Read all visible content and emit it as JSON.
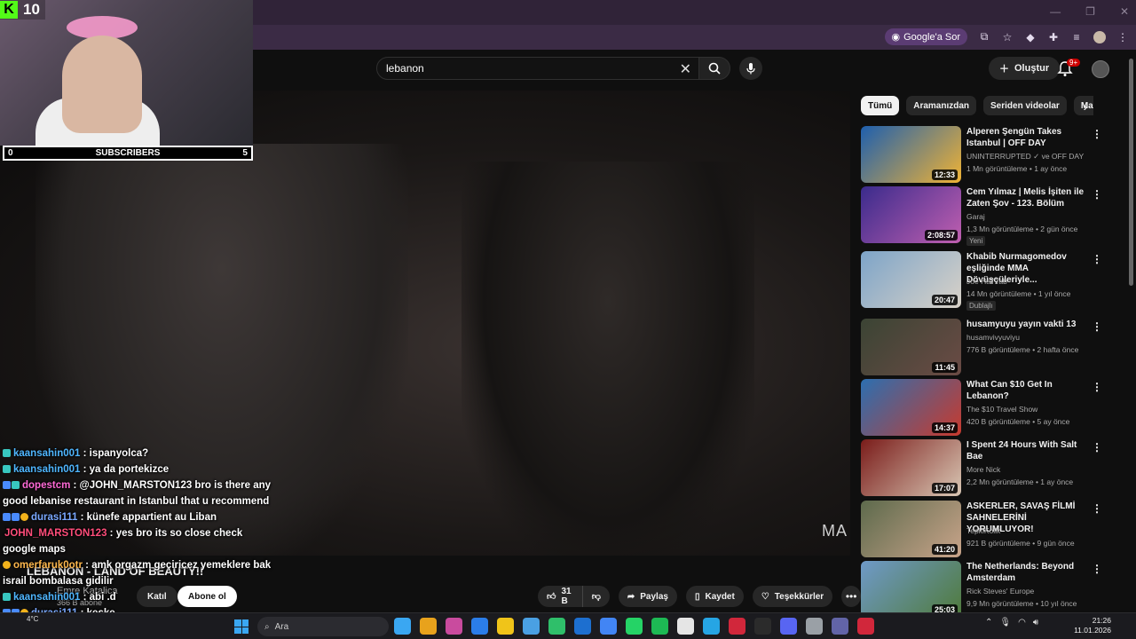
{
  "browser": {
    "google_ask": "Google'a Sor"
  },
  "header": {
    "search_value": "lebanon",
    "create_label": "Oluştur",
    "notif_count": "9+"
  },
  "stream_overlay": {
    "kick_count": "10",
    "subs_left": "0",
    "subs_label": "SUBSCRIBERS",
    "subs_right": "5",
    "accent": "#53fc18"
  },
  "chat": [
    {
      "user": "kaansahin001",
      "text": ": ispanyolca?",
      "color": "#4fb6ff",
      "badges": [
        "teal"
      ]
    },
    {
      "user": "kaansahin001",
      "text": ": ya da portekizce",
      "color": "#4fb6ff",
      "badges": [
        "teal"
      ]
    },
    {
      "user": "dopestcm",
      "text": ": @JOHN_MARSTON123 bro is there any good lebanise restaurant in Istanbul that u recommend",
      "color": "#ff6ad5",
      "badges": [
        "blue",
        "teal"
      ]
    },
    {
      "user": "durasi111",
      "text": ": künefe appartient au Liban",
      "color": "#7aa8ff",
      "badges": [
        "blue",
        "blue",
        "gold"
      ]
    },
    {
      "user": "JOHN_MARSTON123",
      "text": ": yes bro its so close check google maps",
      "color": "#ff4d7a",
      "badges": []
    },
    {
      "user": "omerfaruk0otr",
      "text": ": amk orgazm geçiricez yemeklere bak israil bombalasa gidilir",
      "color": "#ffb84d",
      "badges": [
        "gold"
      ]
    },
    {
      "user": "kaansahin001",
      "text": ": abi .d",
      "color": "#4fb6ff",
      "badges": [
        "teal"
      ]
    },
    {
      "user": "durasi111",
      "text": ": keşke",
      "color": "#7aa8ff",
      "badges": [
        "blue",
        "blue",
        "gold"
      ]
    }
  ],
  "video": {
    "watermark": "MA",
    "title": "LEBANON - LAND OF BEAUTY!!",
    "channel": "Emre Katalica",
    "subscribers": "366 B abone",
    "join_label": "Katıl",
    "subscribe_label": "Abone ol",
    "likes": "31 B",
    "share_label": "Paylaş",
    "save_label": "Kaydet",
    "thanks_label": "Teşekkürler"
  },
  "chips": [
    "Tümü",
    "Aramanızdan",
    "Seriden videolar",
    "Ma"
  ],
  "recommendations": [
    {
      "title": "Alperen Şengün Takes Istanbul | OFF DAY",
      "channel": "UNINTERRUPTED ✓ ve OFF DAY",
      "meta": "1 Mn görüntüleme • 1 ay önce",
      "duration": "12:33",
      "tag": "",
      "colors": [
        "#1e5fae",
        "#f0b335"
      ]
    },
    {
      "title": "Cem Yılmaz | Melis İşiten ile Zaten Şov - 123. Bölüm",
      "channel": "Garaj",
      "meta": "1,3 Mn görüntüleme • 2 gün önce",
      "duration": "2:08:57",
      "tag": "Yeni",
      "colors": [
        "#3a2b8c",
        "#c05fb0"
      ]
    },
    {
      "title": "Khabib Nurmagomedov eşliğinde MMA Dövüşçüleriyle...",
      "channel": "Joe HaTTab",
      "meta": "14 Mn görüntüleme • 1 yıl önce",
      "duration": "20:47",
      "tag": "Dublajlı",
      "colors": [
        "#7da4c8",
        "#d9d2c8"
      ]
    },
    {
      "title": "husamyuyu yayın vakti 13",
      "channel": "husamvivyuviyu",
      "meta": "776 B görüntüleme • 2 hafta önce",
      "duration": "11:45",
      "tag": "",
      "colors": [
        "#3b4434",
        "#6b4b45"
      ]
    },
    {
      "title": "What Can $10 Get In Lebanon?",
      "channel": "The $10 Travel Show",
      "meta": "420 B görüntüleme • 5 ay önce",
      "duration": "14:37",
      "tag": "",
      "colors": [
        "#2c6fb0",
        "#c83a2e"
      ]
    },
    {
      "title": "I Spent 24 Hours With Salt Bae",
      "channel": "More Nick",
      "meta": "2,2 Mn görüntüleme • 1 ay önce",
      "duration": "17:07",
      "tag": "",
      "colors": [
        "#7a1c1a",
        "#d9c7b4"
      ]
    },
    {
      "title": "ASKERLER, SAVAŞ FİLMİ SAHNELERİNİ YORUMLUYOR!",
      "channel": "TepkiKolik",
      "meta": "921 B görüntüleme • 9 gün önce",
      "duration": "41:20",
      "tag": "",
      "colors": [
        "#5d6a4c",
        "#c9a48a"
      ]
    },
    {
      "title": "The Netherlands: Beyond Amsterdam",
      "channel": "Rick Steves' Europe",
      "meta": "9,9 Mn görüntüleme • 10 yıl önce",
      "duration": "25:03",
      "tag": "",
      "colors": [
        "#6f9ac9",
        "#4f7a3a"
      ]
    }
  ],
  "taskbar": {
    "search_placeholder": "Ara",
    "weather": "4°C",
    "time": "21:26",
    "date": "11.01.2026",
    "apps": [
      "#3aa7f2",
      "#e8a21c",
      "#c94b9e",
      "#2b7de9",
      "#f0c419",
      "#4aa0e3",
      "#2fbf6a",
      "#1d6fd0",
      "#4285f4",
      "#25d366",
      "#1db954",
      "#e5e5e5",
      "#26a5e4",
      "#d1273b",
      "#2b2b2b",
      "#5865f2",
      "#9aa0a6",
      "#6264a7",
      "#d1273b"
    ]
  }
}
